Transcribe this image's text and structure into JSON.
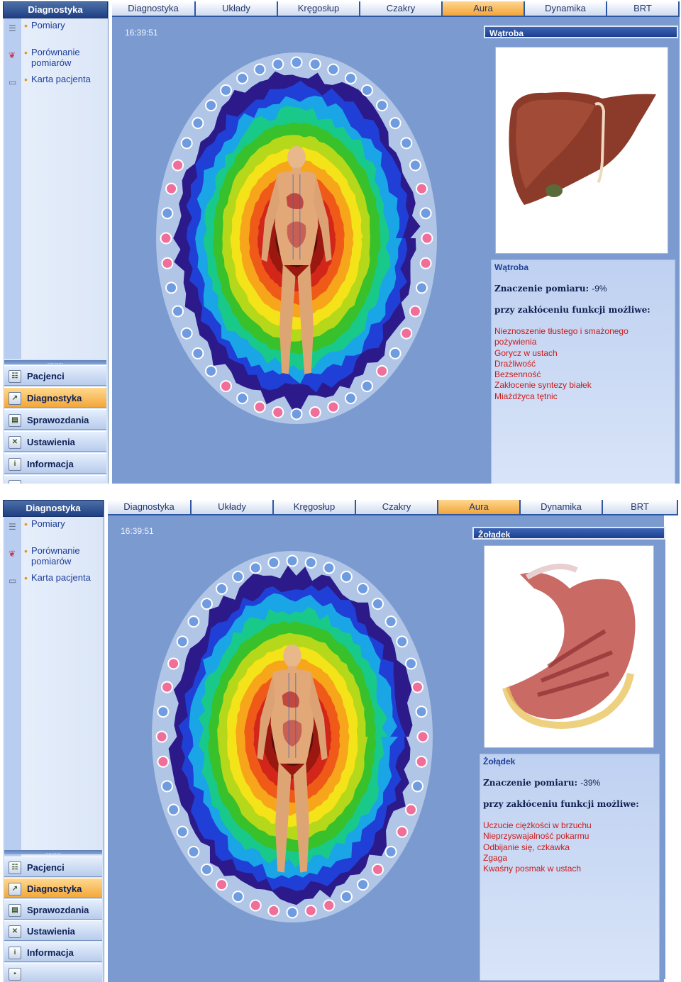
{
  "sidebar": {
    "title": "Diagnostyka",
    "items": [
      {
        "label": "Pomiary",
        "icon": "list-icon"
      },
      {
        "label": "Porównanie pomiarów",
        "icon": "lungs-icon"
      },
      {
        "label": "Karta pacjenta",
        "icon": "book-icon"
      }
    ],
    "separator": "..........",
    "nav": [
      {
        "label": "Pacjenci",
        "icon": "patients-icon"
      },
      {
        "label": "Diagnostyka",
        "icon": "chart-icon"
      },
      {
        "label": "Sprawozdania",
        "icon": "printer-icon"
      },
      {
        "label": "Ustawienia",
        "icon": "tools-icon"
      },
      {
        "label": "Informacja",
        "icon": "info-icon"
      }
    ],
    "active_nav": "Diagnostyka"
  },
  "tabs": [
    "Diagnostyka",
    "Układy",
    "Kręgosłup",
    "Czakry",
    "Aura",
    "Dynamika",
    "BRT"
  ],
  "active_tab": "Aura",
  "time": "16:39:51",
  "screens": [
    {
      "panel_title": "Wątroba",
      "organ": "Wątroba",
      "measurement_label": "Znaczenie pomiaru:",
      "measurement_value": "-9%",
      "heading": "przy zakłóceniu funkcji możliwe:",
      "symptoms": [
        "Nieznoszenie tłustego i smażonego pożywienia",
        "Gorycz w ustach",
        "Drażliwość",
        "Bezsenność",
        "Zakłocenie syntezy białek",
        "Miażdżyca tętnic"
      ],
      "organ_image": "liver-illustration"
    },
    {
      "panel_title": "Żołądek",
      "organ": "Żołądek",
      "measurement_label": "Znaczenie pomiaru:",
      "measurement_value": "-39%",
      "heading": "przy zakłóceniu funkcji możliwe:",
      "symptoms": [
        "Uczucie ciężkości w brzuchu",
        "Nieprzyswajalność pokarmu",
        "Odbijanie się, czkawka",
        "Zgaga",
        "Kwaśny posmak w ustach"
      ],
      "organ_image": "stomach-illustration"
    }
  ],
  "colors": {
    "main_bg": "#7b9bd0",
    "active_tab": "#f2a53a",
    "symptom_text": "#cc1a1a",
    "dot_blue": "#6f9be0",
    "dot_pink": "#f06f9a"
  }
}
